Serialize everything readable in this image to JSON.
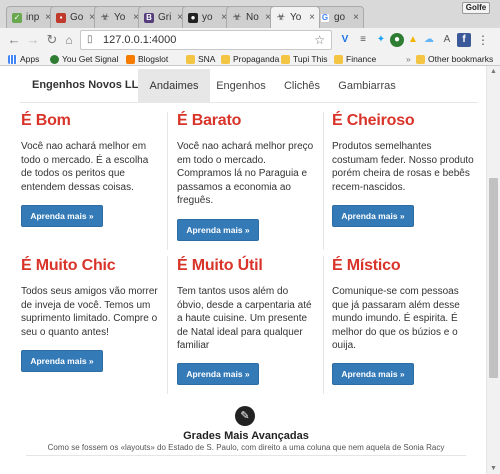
{
  "browser": {
    "tabs": [
      {
        "title": "inp",
        "favicon": "rainbow-icon",
        "color": "#6aa84f"
      },
      {
        "title": "Go",
        "favicon": "image-icon",
        "color": "#c0392b"
      },
      {
        "title": "Yo",
        "favicon": "biohazard-icon",
        "color": "#444444"
      },
      {
        "title": "Gri",
        "favicon": "bootstrap-icon",
        "color": "#563d7c"
      },
      {
        "title": "yo",
        "favicon": "sunglasses-icon",
        "color": "#222222"
      },
      {
        "title": "No",
        "favicon": "biohazard-icon",
        "color": "#444444"
      },
      {
        "title": "Yo",
        "favicon": "biohazard-icon",
        "color": "#444444"
      },
      {
        "title": "go",
        "favicon": "google-icon",
        "color": "#4285f4"
      }
    ],
    "user_badge": "Golfe",
    "url": "127.0.0.1:4000",
    "bookmarks": [
      {
        "label": "Apps",
        "favicon": "apps-grid-icon",
        "color": "#4285f4"
      },
      {
        "label": "You Get Signal",
        "favicon": "signal-icon",
        "color": "#2e7d32"
      },
      {
        "label": "Blogslot",
        "favicon": "blogger-icon",
        "color": "#f57c00"
      },
      {
        "label": "SNA",
        "favicon": "folder-icon",
        "color": "#f4c542"
      },
      {
        "label": "Propaganda",
        "favicon": "folder-icon",
        "color": "#f4c542"
      },
      {
        "label": "Tupi This",
        "favicon": "folder-icon",
        "color": "#f4c542"
      },
      {
        "label": "Finance",
        "favicon": "folder-icon",
        "color": "#f4c542"
      },
      {
        "label": "Other bookmarks",
        "favicon": "folder-icon",
        "color": "#f4c542"
      }
    ]
  },
  "site": {
    "brand": "Engenhos Novos LLC",
    "nav": [
      "Andaimes",
      "Engenhos",
      "Clichês",
      "Gambiarras"
    ],
    "active_nav": "Andaimes",
    "accent_color": "#d9342a",
    "button_color": "#337ab7",
    "features": [
      {
        "title": "É Bom",
        "text": "Você nao achará melhor em todo o mercado. É a escolha de todos os peritos que entendem dessas coisas.",
        "button": "Aprenda mais »"
      },
      {
        "title": "É Barato",
        "text": "Você nao achará melhor preço em todo o mercado. Compramos lá no Paraguia e passamos a economia ao freguês.",
        "button": "Aprenda mais »"
      },
      {
        "title": "É Cheiroso",
        "text": "Produtos semelhantes costumam feder. Nosso produto porém cheira de rosas e bebês recem-nascidos.",
        "button": "Aprenda mais »"
      },
      {
        "title": "É Muito Chic",
        "text": "Todos seus amigos vão morrer de inveja de você. Temos um suprimento limitado. Compre o seu o quanto antes!",
        "button": "Aprenda mais »"
      },
      {
        "title": "É Muito Útil",
        "text": "Tem tantos usos além do óbvio, desde a carpentaria até a haute cuisine. Um presente de Natal ideal para qualquer familiar",
        "button": "Aprenda mais »"
      },
      {
        "title": "É Místico",
        "text": "Comunique-se com pessoas que já passaram além desse mundo imundo. É espirita. É melhor do que os búzios e o ouija.",
        "button": "Aprenda mais »"
      }
    ],
    "footer": {
      "icon": "pencil-icon",
      "title": "Grades Mais Avançadas",
      "subtitle": "Como se fossem os «layouts» do Estado de S. Paulo, com direito a uma coluna que nem aquela de Sonia Racy"
    }
  }
}
